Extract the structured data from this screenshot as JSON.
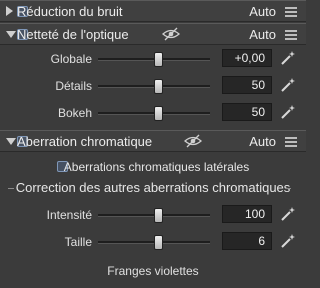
{
  "sections": {
    "noise": {
      "title": "Réduction du bruit",
      "mode": "Auto",
      "expanded": false
    },
    "sharpness": {
      "title": "Netteté de l'optique",
      "mode": "Auto",
      "expanded": true,
      "rows": [
        {
          "label": "Globale",
          "value": "+0,00",
          "level": 0.5
        },
        {
          "label": "Détails",
          "value": "50",
          "level": 0.5
        },
        {
          "label": "Bokeh",
          "value": "50",
          "level": 0.5
        }
      ]
    },
    "chromatic": {
      "title": "Aberration chromatique",
      "mode": "Auto",
      "expanded": true,
      "lateral_label": "Aberrations chromatiques latérales",
      "subgroup_title": "Correction des autres aberrations chromatiques",
      "rows": [
        {
          "label": "Intensité",
          "value": "100",
          "level": 0.5
        },
        {
          "label": "Taille",
          "value": "6",
          "level": 0.5
        }
      ],
      "fringe_label": "Franges violettes"
    }
  },
  "colors": {
    "background": "#3b3b3b",
    "header": "#404040",
    "text": "#e6e6e6",
    "checkbox_accent": "#7f97b8"
  }
}
